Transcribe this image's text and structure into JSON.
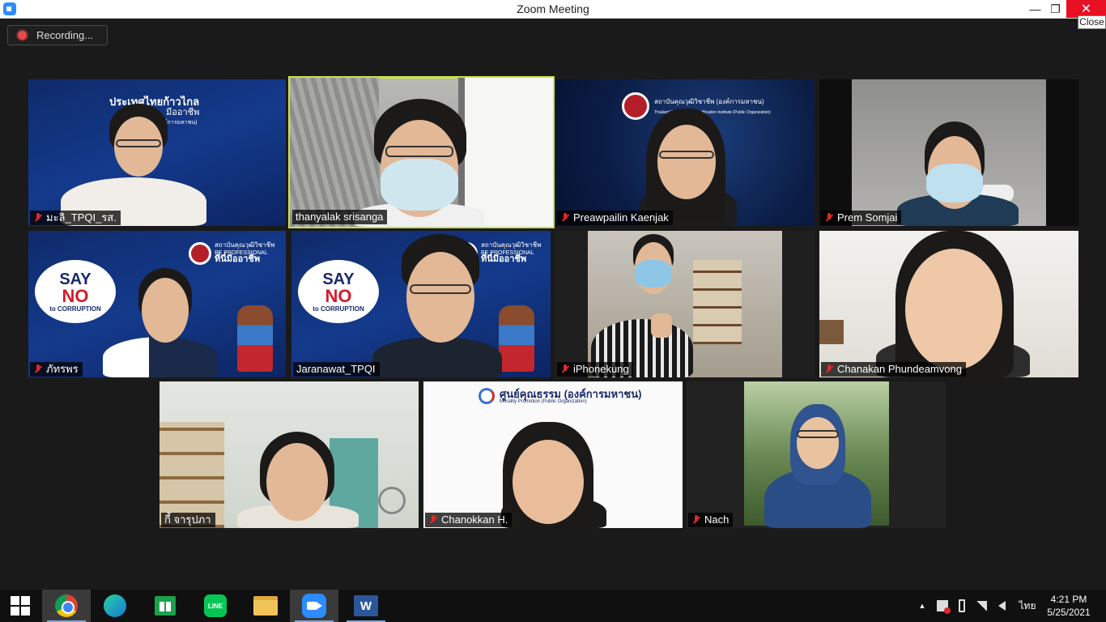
{
  "window": {
    "title": "Zoom Meeting",
    "minimize_glyph": "—",
    "maximize_glyph": "❐",
    "close_glyph": "✕",
    "close_tooltip": "Close"
  },
  "recording": {
    "label": "Recording..."
  },
  "participants": [
    {
      "name": "มะลิ_TPQI_รส.",
      "muted": true,
      "active_speaker": false
    },
    {
      "name": "thanyalak srisanga",
      "muted": false,
      "active_speaker": true
    },
    {
      "name": "Preawpailin Kaenjak",
      "muted": true,
      "active_speaker": false
    },
    {
      "name": "Prem Somjai",
      "muted": true,
      "active_speaker": false
    },
    {
      "name": "ภัทรพร",
      "muted": true,
      "active_speaker": false
    },
    {
      "name": "Jaranawat_TPQI",
      "muted": false,
      "active_speaker": false
    },
    {
      "name": "iPhonekung",
      "muted": true,
      "active_speaker": false
    },
    {
      "name": "Chanakan Phundeamvong",
      "muted": true,
      "active_speaker": false
    },
    {
      "name": "กี้ จารุปภา",
      "muted": false,
      "active_speaker": false
    },
    {
      "name": "Chanokkan H.",
      "muted": true,
      "active_speaker": false
    },
    {
      "name": "Nach",
      "muted": true,
      "active_speaker": false
    },
    {
      "name": "",
      "muted": false,
      "active_speaker": false
    }
  ],
  "virtual_backgrounds": {
    "tpqi_banner_line1": "ประเทศไทยก้าวไกล",
    "tpqi_banner_line2": "มีออาชีพ",
    "tpqi_banner_line3": "ฟ (องค์การมหาชน)",
    "say_no_1": "SAY",
    "say_no_2": "NO",
    "say_no_3": "to CORRUPTION",
    "tpqi_org": "สถาบันคุณวุฒิวิชาชีพ",
    "be_professional": "BE PROFESSIONAL",
    "slogan": "ที่นี่มีออาชีพ",
    "tpqi_header": "สถาบันคุณวุฒิวิชาชีพ (องค์การมหาชน)",
    "tpqi_sub": "Thailand Professional Qualification Institute (Public Organization)",
    "morality_title": "ศูนย์คุณธรรม (องค์การมหาชน)",
    "morality_sub": "Morality Promotion (Public Organization)"
  },
  "taskbar": {
    "apps": [
      "windows-start",
      "chrome",
      "edge",
      "microsoft-store",
      "line",
      "file-explorer",
      "zoom",
      "word"
    ],
    "line_label": "LINE",
    "word_label": "W",
    "language": "ไทย",
    "time": "4:21 PM",
    "date": "5/25/2021",
    "tray_up": "▲"
  }
}
